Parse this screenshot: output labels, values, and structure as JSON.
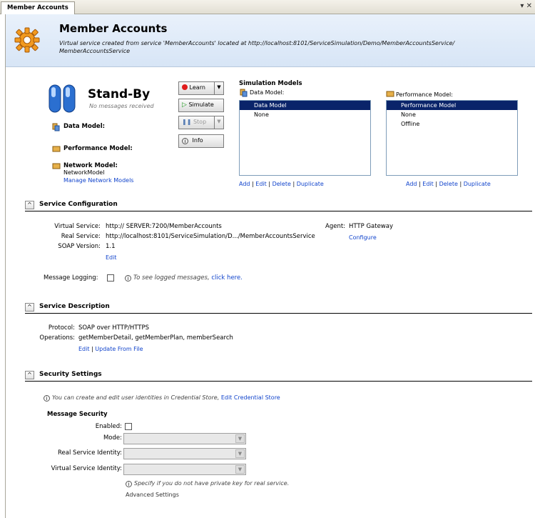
{
  "tab": {
    "title": "Member Accounts",
    "controls": "▾ ✕"
  },
  "header": {
    "title": "Member Accounts",
    "subtitle": "Virtual service created from service 'MemberAccounts' located at http://localhost:8101/ServiceSimulation/Demo/MemberAccountsService/ MemberAccountsService"
  },
  "status": {
    "title": "Stand-By",
    "message": "No messages received"
  },
  "left_labels": {
    "data_model": "Data Model:",
    "performance_model": "Performance Model:",
    "network_model": "Network Model:",
    "network_model_value": "NetworkModel",
    "manage_network": "Manage Network Models"
  },
  "buttons": {
    "learn": "Learn",
    "simulate": "Simulate",
    "stop": "Stop",
    "info": "Info"
  },
  "simulation": {
    "title": "Simulation Models",
    "data_model_label": "Data Model:",
    "data_models": [
      "Data Model",
      "None"
    ],
    "performance_model_label": "Performance Model:",
    "performance_models": [
      "Performance Model",
      "None",
      "Offline"
    ],
    "actions": {
      "add": "Add",
      "edit": "Edit",
      "delete": "Delete",
      "duplicate": "Duplicate",
      "sep": "|"
    }
  },
  "service_config": {
    "title": "Service Configuration",
    "virtual_label": "Virtual Service:",
    "virtual_value": "http:// SERVER:7200/MemberAccounts",
    "real_label": "Real Service:",
    "real_value": "http://localhost:8101/ServiceSimulation/D.../MemberAccountsService",
    "soap_label": "SOAP Version:",
    "soap_value": "1.1",
    "edit": "Edit",
    "agent_label": "Agent:",
    "agent_value": "HTTP Gateway",
    "configure": "Configure",
    "logging_label": "Message Logging:",
    "logging_note": "To see logged messages,",
    "click_here": "click here."
  },
  "service_desc": {
    "title": "Service Description",
    "protocol_label": "Protocol:",
    "protocol_value": "SOAP over HTTP/HTTPS",
    "operations_label": "Operations:",
    "operations_value": "getMemberDetail, getMemberPlan, memberSearch",
    "edit": "Edit",
    "sep": "|",
    "update": "Update From File"
  },
  "security": {
    "title": "Security Settings",
    "note": "You can create and edit user identities in Credential Store,",
    "edit_store": "Edit Credential Store",
    "msg_security": "Message Security",
    "enabled_label": "Enabled:",
    "mode_label": "Mode:",
    "real_identity_label": "Real Service Identity:",
    "virtual_identity_label": "Virtual Service Identity:",
    "hint": "Specify if you do not have private key for real service.",
    "advanced": "Advanced Settings"
  },
  "colors": {
    "accent": "#0a246a",
    "link": "#1144cc",
    "header_bg": "#dde9f7"
  }
}
